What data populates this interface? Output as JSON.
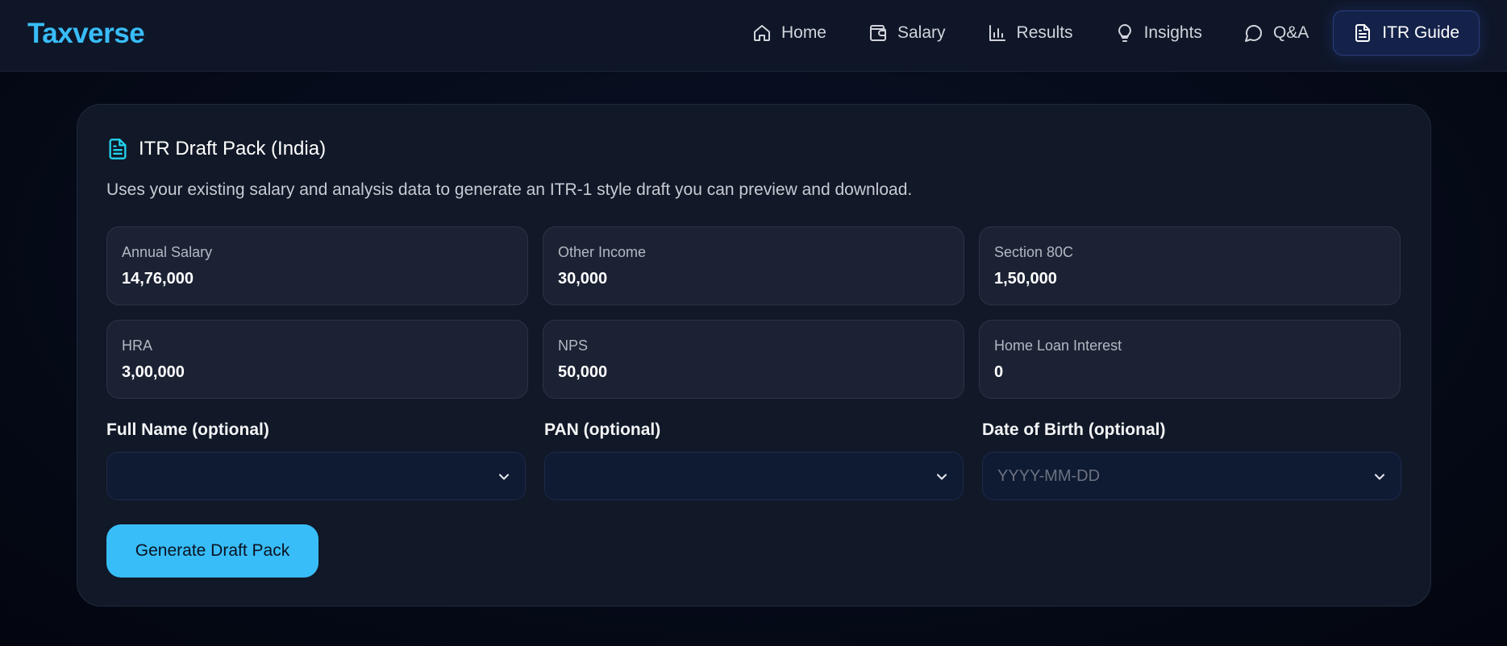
{
  "header": {
    "brand": "Taxverse",
    "nav": [
      {
        "label": "Home",
        "icon": "home-icon"
      },
      {
        "label": "Salary",
        "icon": "wallet-icon"
      },
      {
        "label": "Results",
        "icon": "bar-chart-icon"
      },
      {
        "label": "Insights",
        "icon": "lightbulb-icon"
      },
      {
        "label": "Q&A",
        "icon": "chat-bubble-icon"
      },
      {
        "label": "ITR Guide",
        "icon": "document-icon",
        "active": true
      }
    ]
  },
  "card": {
    "title": "ITR Draft Pack (India)",
    "title_icon": "document-icon",
    "description": "Uses your existing salary and analysis data to generate an ITR-1 style draft you can preview and download.",
    "stats": [
      {
        "label": "Annual Salary",
        "value": "14,76,000"
      },
      {
        "label": "Other Income",
        "value": "30,000"
      },
      {
        "label": "Section 80C",
        "value": "1,50,000"
      },
      {
        "label": "HRA",
        "value": "3,00,000"
      },
      {
        "label": "NPS",
        "value": "50,000"
      },
      {
        "label": "Home Loan Interest",
        "value": "0"
      }
    ],
    "fields": [
      {
        "label": "Full Name (optional)",
        "value": "",
        "placeholder": ""
      },
      {
        "label": "PAN (optional)",
        "value": "",
        "placeholder": ""
      },
      {
        "label": "Date of Birth (optional)",
        "value": "",
        "placeholder": "YYYY-MM-DD"
      }
    ],
    "button_label": "Generate Draft Pack"
  },
  "colors": {
    "accent": "#38bdf8",
    "active_nav_bg": "#14224a",
    "card_bg": "#111827",
    "icon_cyan": "#22d3ee"
  }
}
